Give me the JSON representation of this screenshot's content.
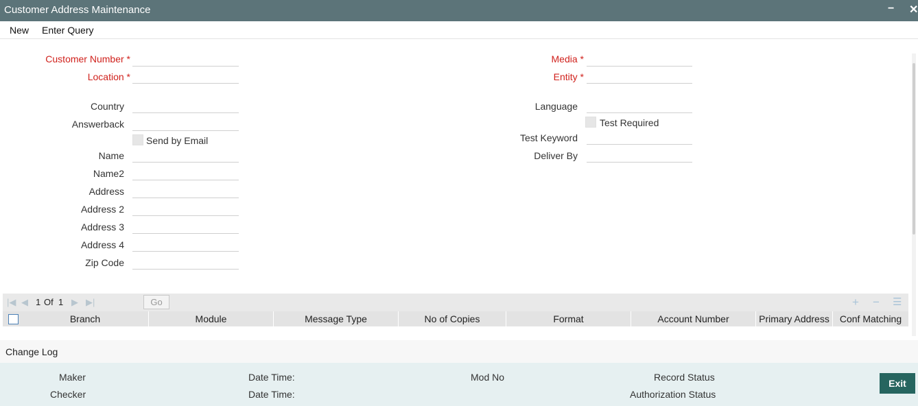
{
  "window": {
    "title": "Customer Address Maintenance",
    "minimize_glyph": "−",
    "close_glyph": "✕"
  },
  "menu": {
    "new": "New",
    "enter_query": "Enter Query"
  },
  "form": {
    "customer_number": {
      "label": "Customer Number",
      "required": "*",
      "value": ""
    },
    "location": {
      "label": "Location",
      "required": "*",
      "value": ""
    },
    "country": {
      "label": "Country",
      "value": ""
    },
    "answerback": {
      "label": "Answerback",
      "value": ""
    },
    "send_by_email": {
      "label": "Send by Email",
      "checked": false
    },
    "name": {
      "label": "Name",
      "value": ""
    },
    "name2": {
      "label": "Name2",
      "value": ""
    },
    "address": {
      "label": "Address",
      "value": ""
    },
    "address2": {
      "label": "Address 2",
      "value": ""
    },
    "address3": {
      "label": "Address 3",
      "value": ""
    },
    "address4": {
      "label": "Address 4",
      "value": ""
    },
    "zip_code": {
      "label": "Zip Code",
      "value": ""
    },
    "media": {
      "label": "Media",
      "required": "*",
      "value": ""
    },
    "entity": {
      "label": "Entity",
      "required": "*",
      "value": ""
    },
    "language": {
      "label": "Language",
      "value": ""
    },
    "test_required": {
      "label": "Test Required",
      "checked": false
    },
    "test_keyword": {
      "label": "Test Keyword",
      "value": ""
    },
    "deliver_by": {
      "label": "Deliver By",
      "value": ""
    }
  },
  "grid": {
    "pager": {
      "current": "1",
      "of_label": "Of",
      "total": "1",
      "go_label": "Go"
    },
    "icons": [
      "first-page-icon",
      "prev-page-icon",
      "next-page-icon",
      "last-page-icon",
      "add-row-icon",
      "delete-row-icon",
      "single-view-icon"
    ],
    "columns": [
      "Branch",
      "Module",
      "Message Type",
      "No of Copies",
      "Format",
      "Account Number",
      "Primary Address",
      "Conf Matching"
    ],
    "rows": []
  },
  "change_log": {
    "label": "Change Log"
  },
  "audit": {
    "maker": "Maker",
    "checker": "Checker",
    "date_time_1": "Date Time:",
    "date_time_2": "Date Time:",
    "mod_no": "Mod No",
    "record_status": "Record Status",
    "authorization_status": "Authorization Status"
  },
  "buttons": {
    "exit": "Exit"
  },
  "colors": {
    "titlebar": "#5c7479",
    "required": "#d0211c",
    "audit_bg": "#e6f0f1",
    "exit_bg": "#26655f"
  }
}
